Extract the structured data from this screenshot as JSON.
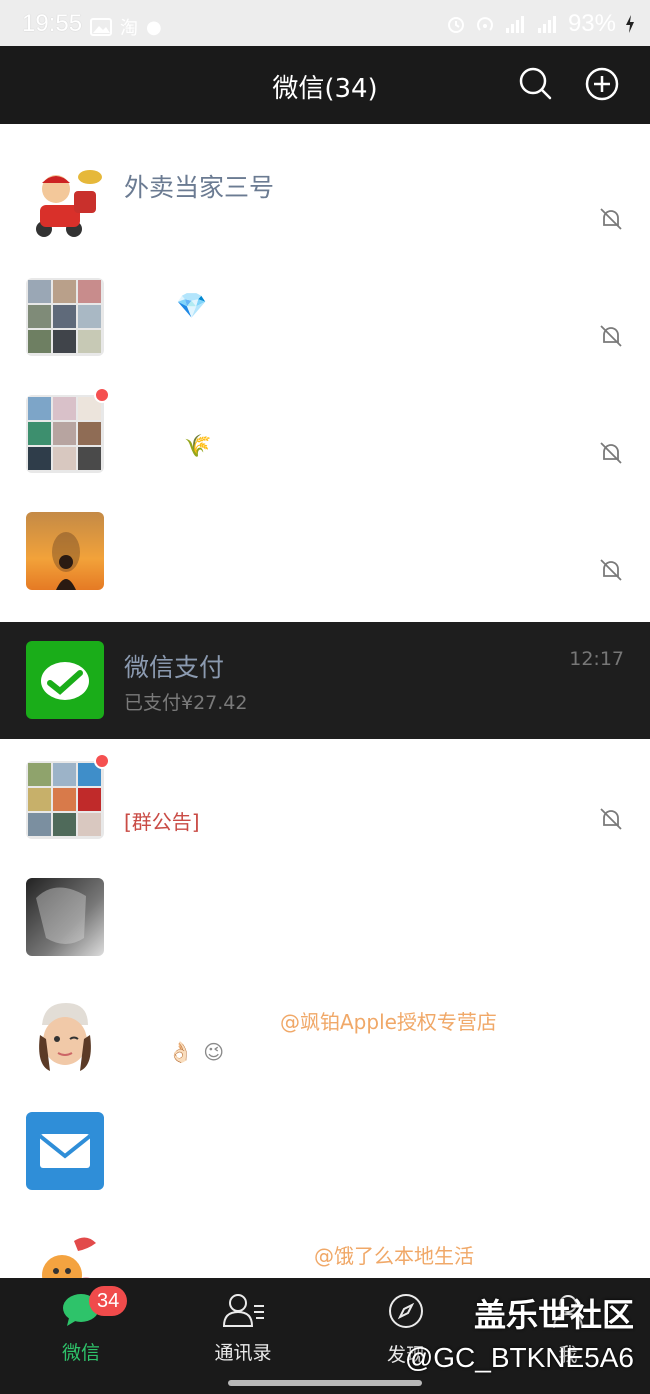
{
  "status_bar": {
    "time": "19:55",
    "left_icons": [
      "image-icon",
      "taobao-icon",
      "dot-icon"
    ],
    "right_icons": [
      "alarm-icon",
      "hotspot-icon",
      "hd-signal-icon",
      "5g-signal-icon",
      "hd-signal-icon",
      "4g-signal-icon"
    ],
    "battery": "93%"
  },
  "header": {
    "title": "微信(34)",
    "search_icon": "search-icon",
    "add_icon": "plus-circle-icon"
  },
  "chats": [
    {
      "name": "",
      "preview": "",
      "time": "",
      "muted": true
    },
    {
      "name": "外卖当家三号",
      "preview": "",
      "time": "",
      "muted": true
    },
    {
      "name": "💎",
      "preview": "",
      "time": "",
      "muted": true
    },
    {
      "name": "",
      "preview": "🌾",
      "time": "",
      "muted": true,
      "unread_dot": true
    },
    {
      "name": "",
      "preview": "",
      "time": "",
      "muted": true
    },
    {
      "name": "微信支付",
      "preview": "已支付¥27.42",
      "time": "12:17",
      "muted": false,
      "highlighted": true
    },
    {
      "name": "",
      "preview": "[群公告]",
      "time": "",
      "muted": true,
      "unread_dot": true
    },
    {
      "name": "",
      "preview": "",
      "time": "",
      "muted": false
    },
    {
      "name": "@飒铂Apple授权专营店",
      "preview": "👌🏻 😉",
      "time": "",
      "muted": false
    },
    {
      "name": "",
      "preview": "",
      "time": "",
      "muted": false
    },
    {
      "name": "@饿了么本地生活",
      "preview": "",
      "time": "",
      "muted": false
    }
  ],
  "tab_bar": {
    "tabs": [
      {
        "label": "微信",
        "icon": "chat-bubble-icon",
        "badge": "34",
        "active": true
      },
      {
        "label": "通讯录",
        "icon": "contacts-icon",
        "active": false
      },
      {
        "label": "发现",
        "icon": "compass-icon",
        "active": false
      },
      {
        "label": "我",
        "icon": "person-icon",
        "active": false
      }
    ]
  },
  "watermark": {
    "line1": "盖乐世社区",
    "line2": "@GC_BTKNE5A6"
  },
  "colors": {
    "header_bg": "#1a1a1a",
    "active_tab": "#2ec36a",
    "badge": "#f04b4b",
    "name_text": "#6b7b92",
    "wechat_pay_green": "#1aad19"
  }
}
